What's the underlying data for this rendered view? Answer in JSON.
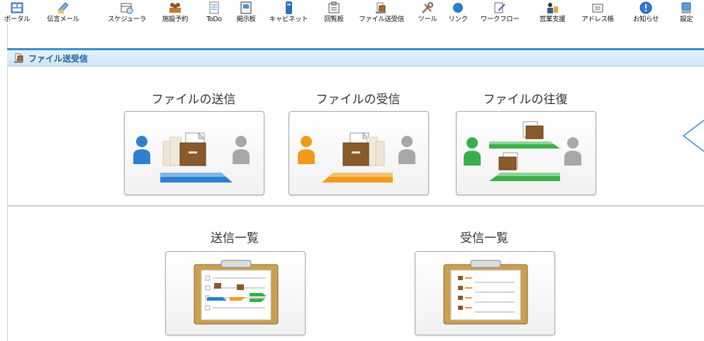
{
  "toolbar": {
    "items": [
      {
        "label": "ポータル",
        "icon": "portal-icon"
      },
      {
        "label": "伝言メール",
        "icon": "memo-mail-icon"
      },
      {
        "label": "スケジューラ",
        "icon": "scheduler-icon"
      },
      {
        "label": "施設予約",
        "icon": "facility-icon"
      },
      {
        "label": "ToDo",
        "icon": "todo-icon"
      },
      {
        "label": "掲示板",
        "icon": "bulletin-icon"
      },
      {
        "label": "キャビネット",
        "icon": "cabinet-icon"
      },
      {
        "label": "回覧板",
        "icon": "circular-icon"
      },
      {
        "label": "ファイル送受信",
        "icon": "file-transfer-icon"
      },
      {
        "label": "ツール",
        "icon": "tool-icon"
      },
      {
        "label": "リンク",
        "icon": "link-icon"
      },
      {
        "label": "ワークフロー",
        "icon": "workflow-icon"
      },
      {
        "label": "営業支援",
        "icon": "sales-icon"
      },
      {
        "label": "アドレス帳",
        "icon": "address-book-icon"
      },
      {
        "label": "お知らせ",
        "icon": "notice-icon"
      },
      {
        "label": "設定",
        "icon": "settings-icon"
      }
    ]
  },
  "header": {
    "title": "ファイル送受信"
  },
  "actions": {
    "send": "ファイルの送信",
    "receive": "ファイルの受信",
    "exchange": "ファイルの往復"
  },
  "lists": {
    "sent": "送信一覧",
    "received": "受信一覧"
  },
  "colors": {
    "send_blue": "#2f7fd0",
    "receive_orange": "#f39a1e",
    "exchange_green": "#3aae4a",
    "header_text": "#1d5f9c"
  }
}
